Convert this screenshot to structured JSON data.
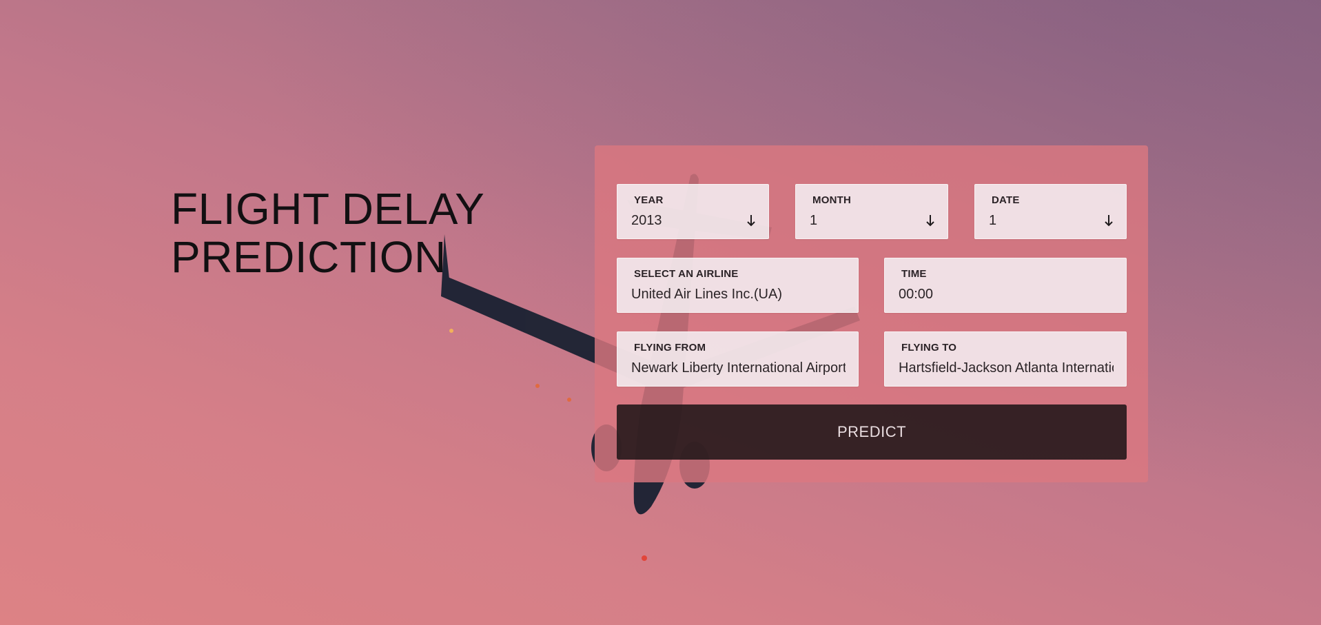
{
  "hero": {
    "title_line1": "FLIGHT DELAY",
    "title_line2": "PREDICTION"
  },
  "form": {
    "year": {
      "label": "YEAR",
      "value": "2013",
      "icon": "arrow-down-icon"
    },
    "month": {
      "label": "MONTH",
      "value": "1",
      "icon": "arrow-down-icon"
    },
    "date": {
      "label": "DATE",
      "value": "1",
      "icon": "arrow-down-icon"
    },
    "airline": {
      "label": "SELECT AN AIRLINE",
      "value": "United Air Lines Inc.(UA)"
    },
    "time": {
      "label": "TIME",
      "value": "00:00"
    },
    "flying_from": {
      "label": "FLYING FROM",
      "value": "Newark Liberty International Airport"
    },
    "flying_to": {
      "label": "FLYING TO",
      "value": "Hartsfield-Jackson Atlanta International Airport"
    },
    "predict_label": "PREDICT"
  },
  "colors": {
    "background_top": "#8e6480",
    "background_bottom": "#dd8285",
    "card": "#da7880",
    "button": "#201618"
  }
}
